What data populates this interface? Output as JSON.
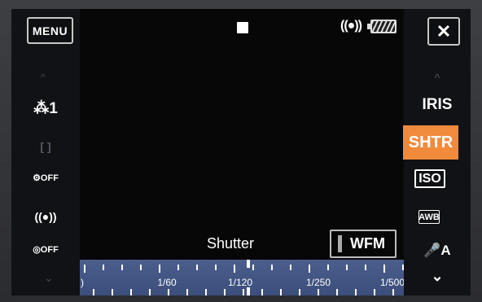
{
  "top_bar": {
    "menu_label": "MENU",
    "close_label": "✕",
    "record_icon": "stop-square-icon",
    "stabilizer_label": "((●))",
    "battery_icon": "battery-icon"
  },
  "left_panel": {
    "up_arrow": "^",
    "down_arrow": "⌄",
    "items": [
      {
        "name": "face-detect-icon",
        "label": "⁂1"
      },
      {
        "name": "focus-frame-icon",
        "label": "[  ]"
      },
      {
        "name": "af-off-icon",
        "label": "⚙OFF"
      },
      {
        "name": "image-stabilizer-icon",
        "label": "((●))"
      },
      {
        "name": "tracking-off-icon",
        "label": "◎OFF"
      }
    ]
  },
  "right_panel": {
    "up_arrow": "^",
    "iris_label": "IRIS",
    "shtr_label": "SHTR",
    "iso_label": "ISO",
    "awb_label": "AWB",
    "mic_label": "🎤A",
    "down_arrow": "⌄",
    "accent_color": "#f28a3c"
  },
  "shutter": {
    "label": "Shutter",
    "wfm_label": "WFM",
    "scale_labels": [
      "1/60",
      "1/120",
      "1/250",
      "1/500"
    ],
    "left_edge_label": ")",
    "selected_value": "1/120"
  }
}
